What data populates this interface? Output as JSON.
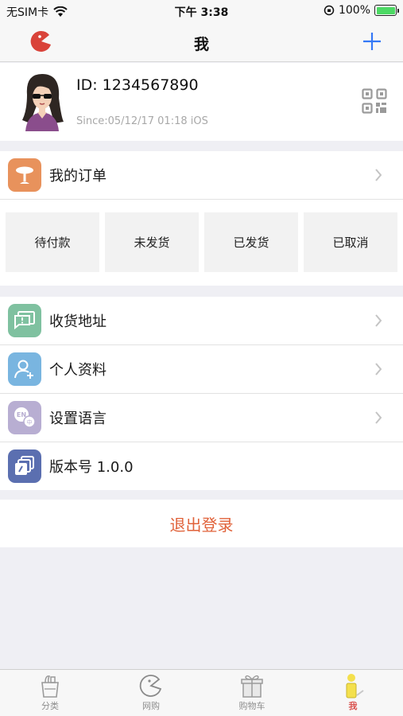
{
  "status_bar": {
    "carrier": "无SIM卡",
    "time": "下午 3:38",
    "battery": "100%"
  },
  "nav": {
    "title": "我"
  },
  "profile": {
    "id_text": "ID: 1234567890",
    "since_text": "Since:05/12/17 01:18  iOS"
  },
  "orders": {
    "label": "我的订单",
    "statuses": [
      "待付款",
      "未发货",
      "已发货",
      "已取消"
    ]
  },
  "menu": {
    "address": "收货地址",
    "profile": "个人资料",
    "language": "设置语言",
    "version": "版本号 1.0.0"
  },
  "logout": "退出登录",
  "tabs": {
    "category": "分类",
    "shop": "网购",
    "cart": "购物车",
    "me": "我"
  },
  "colors": {
    "accent": "#e0623a",
    "nav_plus": "#3478f6",
    "orders_icon": "#e8925c",
    "address_icon": "#7fc1a0",
    "profile_icon": "#79b5e0",
    "language_icon": "#b8aed2",
    "version_icon": "#5b6fb0"
  }
}
